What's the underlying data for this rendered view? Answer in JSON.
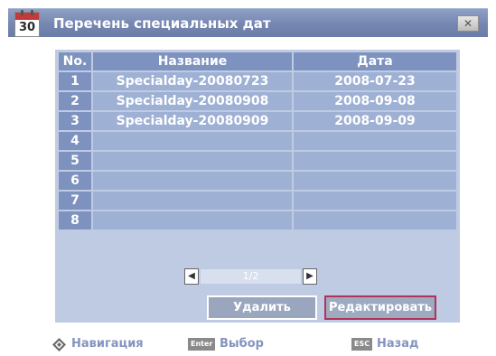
{
  "window": {
    "title": "Перечень специальных дат",
    "calendar_day": "30",
    "close_symbol": "✕"
  },
  "table": {
    "headers": {
      "no": "No.",
      "name": "Название",
      "date": "Дата"
    },
    "rows": [
      {
        "no": "1",
        "name": "Specialday-20080723",
        "date": "2008-07-23"
      },
      {
        "no": "2",
        "name": "Specialday-20080908",
        "date": "2008-09-08"
      },
      {
        "no": "3",
        "name": "Specialday-20080909",
        "date": "2008-09-09"
      },
      {
        "no": "4",
        "name": "",
        "date": ""
      },
      {
        "no": "5",
        "name": "",
        "date": ""
      },
      {
        "no": "6",
        "name": "",
        "date": ""
      },
      {
        "no": "7",
        "name": "",
        "date": ""
      },
      {
        "no": "8",
        "name": "",
        "date": ""
      }
    ]
  },
  "pager": {
    "label": "1/2",
    "prev_icon": "arrow-left-icon",
    "next_icon": "arrow-right-icon"
  },
  "buttons": {
    "delete": "Удалить",
    "edit": "Редактировать"
  },
  "footer": {
    "nav_label": "Навигация",
    "enter_key": "Enter",
    "enter_label": "Выбор",
    "esc_key": "ESC",
    "esc_label": "Назад"
  },
  "colors": {
    "titlebar": "#7586b1",
    "header_cell": "#7e92bf",
    "data_cell": "#9eb0d4",
    "panel": "#bfcbe3",
    "footer_text": "#8494bd",
    "edit_focus_border": "#b0335a"
  }
}
